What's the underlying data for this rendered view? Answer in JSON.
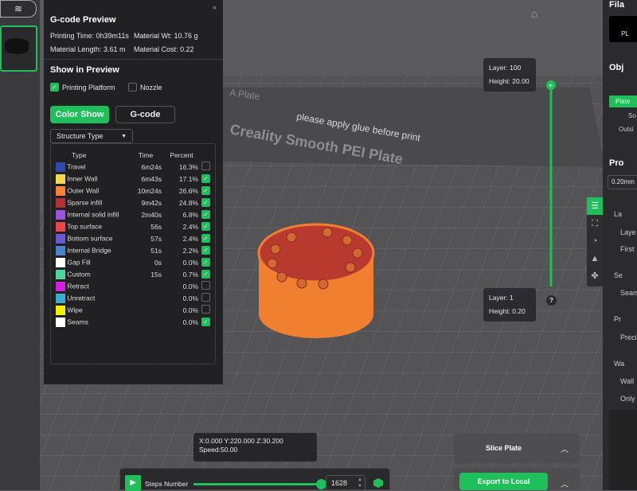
{
  "gcode_preview": {
    "title": "G-code Preview",
    "printing_time": "Printing Time: 0h39m11s",
    "material_wt": "Material Wt: 10.76 g",
    "material_length": "Material Length: 3.61 m",
    "material_cost": "Material Cost: 0.22",
    "collapse_icon": "«",
    "show_in_preview": "Show in Preview",
    "printing_platform": "Printing Platform",
    "nozzle": "Nozzle",
    "color_show": "Color Show",
    "gcode": "G-code",
    "structure_select": "Structure Type",
    "headers": [
      "Type",
      "Time",
      "Percent"
    ],
    "rows": [
      {
        "type": "Travel",
        "time": "6m24s",
        "percent": "16.3%",
        "color": "#2f4aa8",
        "checked": false
      },
      {
        "type": "Inner Wall",
        "time": "6m43s",
        "percent": "17.1%",
        "color": "#f7d84a",
        "checked": true
      },
      {
        "type": "Outer Wall",
        "time": "10m24s",
        "percent": "26.6%",
        "color": "#f5813a",
        "checked": true
      },
      {
        "type": "Sparse infill",
        "time": "9m42s",
        "percent": "24.8%",
        "color": "#b43030",
        "checked": true
      },
      {
        "type": "Internal solid infill",
        "time": "2m40s",
        "percent": "6.8%",
        "color": "#9a55d6",
        "checked": true
      },
      {
        "type": "Top surface",
        "time": "56s",
        "percent": "2.4%",
        "color": "#e84848",
        "checked": true
      },
      {
        "type": "Bottom surface",
        "time": "57s",
        "percent": "2.4%",
        "color": "#6a5ad2",
        "checked": true
      },
      {
        "type": "Internal Bridge",
        "time": "51s",
        "percent": "2.2%",
        "color": "#4a84c8",
        "checked": true
      },
      {
        "type": "Gap Fill",
        "time": "0s",
        "percent": "0.0%",
        "color": "#ffffff",
        "checked": true
      },
      {
        "type": "Custom",
        "time": "15s",
        "percent": "0.7%",
        "color": "#4cd69a",
        "checked": true
      },
      {
        "type": "Retract",
        "time": "",
        "percent": "0.0%",
        "color": "#d020d8",
        "checked": false
      },
      {
        "type": "Unretract",
        "time": "",
        "percent": "0.0%",
        "color": "#3aaed0",
        "checked": false
      },
      {
        "type": "Wipe",
        "time": "",
        "percent": "0.0%",
        "color": "#f4f000",
        "checked": false
      },
      {
        "type": "Seams",
        "time": "",
        "percent": "0.0%",
        "color": "#ffffff",
        "checked": true
      }
    ]
  },
  "plate": {
    "name": "A Plate",
    "brand": "Creality Smooth PEI Plate",
    "note": "please apply glue before print"
  },
  "layer_top": {
    "layer": "Layer: 100",
    "height": "Height: 20.00"
  },
  "layer_bottom": {
    "layer": "Layer: 1",
    "height": "Height: 0.20"
  },
  "help": "?",
  "position": {
    "coords": "X:0.000  Y:220.000  Z:30.200",
    "speed": "Speed:50.00"
  },
  "steps": {
    "label": "Steps Number",
    "value": "1628",
    "progress": 1.0
  },
  "slice_plate": "Slice Plate",
  "export": "Export to Local",
  "right": {
    "filament": "Fila",
    "pl": "PL",
    "object": "Obj",
    "plate": "Plate",
    "so": "So",
    "outside": "Outsi",
    "process": "Pro",
    "layer_height": "0.20mm",
    "la": "La",
    "laye": "Laye",
    "first": "First",
    "se": "Se",
    "seam": "Seam",
    "pr": "Pr",
    "preci": "Preci",
    "wa": "Wa",
    "wall": "Wall",
    "only": "Only"
  },
  "colors": {
    "accent": "#1fbf5a",
    "object": "#f5813a",
    "top": "#c0392b"
  }
}
